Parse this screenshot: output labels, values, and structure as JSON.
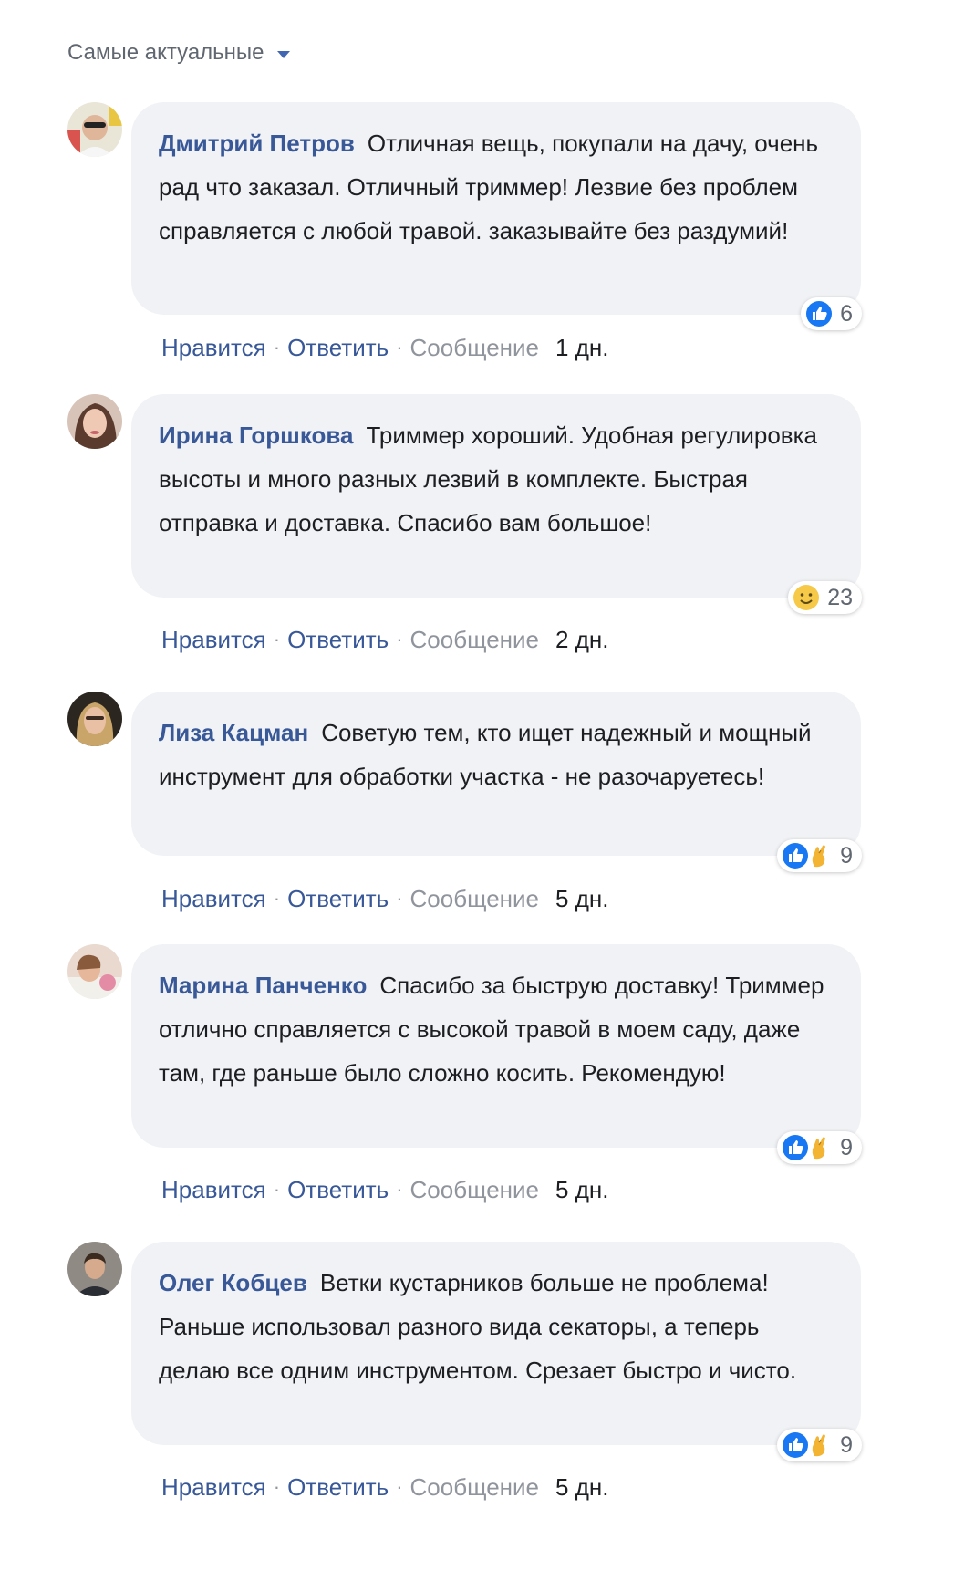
{
  "sort": {
    "label": "Самые актуальные",
    "caret_icon": "chevron-down-icon"
  },
  "colors": {
    "author": "#385898",
    "link": "#385898",
    "muted": "#90949c",
    "bubble": "#f0f2f5",
    "like_blue": "#1877f2"
  },
  "actions": {
    "like": "Нравится",
    "reply": "Ответить",
    "message": "Сообщение",
    "separator": "·"
  },
  "comments": [
    {
      "author": "Дмитрий Петров",
      "text": "Отличная вещь, покупали на дачу, очень рад что заказал. Отличный триммер! Лезвие без проблем справляется с любой травой. заказывайте без раздумий!",
      "reaction_icons": [
        "like-icon"
      ],
      "reaction_count": "6",
      "time": "1 дн."
    },
    {
      "author": "Ирина Горшкова",
      "text": "Триммер хороший. Удобная регулировка высоты и много разных лезвий в комплекте. Быстрая отправка и доставка. Спасибо вам большое!",
      "reaction_icons": [
        "smile-icon"
      ],
      "reaction_count": "23",
      "time": "2 дн."
    },
    {
      "author": "Лиза Кацман",
      "text": "Советую тем, кто ищет надежный и мощный инструмент для обработки участка - не разочаруетесь!",
      "reaction_icons": [
        "like-icon",
        "fingers-crossed-icon"
      ],
      "reaction_count": "9",
      "time": "5 дн."
    },
    {
      "author": "Марина Панченко",
      "text": "Спасибо за быструю доставку! Триммер отлично справляется с высокой травой в моем саду, даже там, где раньше было сложно косить. Рекомендую!",
      "reaction_icons": [
        "like-icon",
        "fingers-crossed-icon"
      ],
      "reaction_count": "9",
      "time": "5 дн."
    },
    {
      "author": "Олег Кобцев",
      "text": "Ветки кустарников больше не проблема! Раньше использовал разного вида секаторы, а теперь делаю все одним инструментом. Срезает быстро и чисто.",
      "reaction_icons": [
        "like-icon",
        "fingers-crossed-icon"
      ],
      "reaction_count": "9",
      "time": "5 дн."
    }
  ]
}
